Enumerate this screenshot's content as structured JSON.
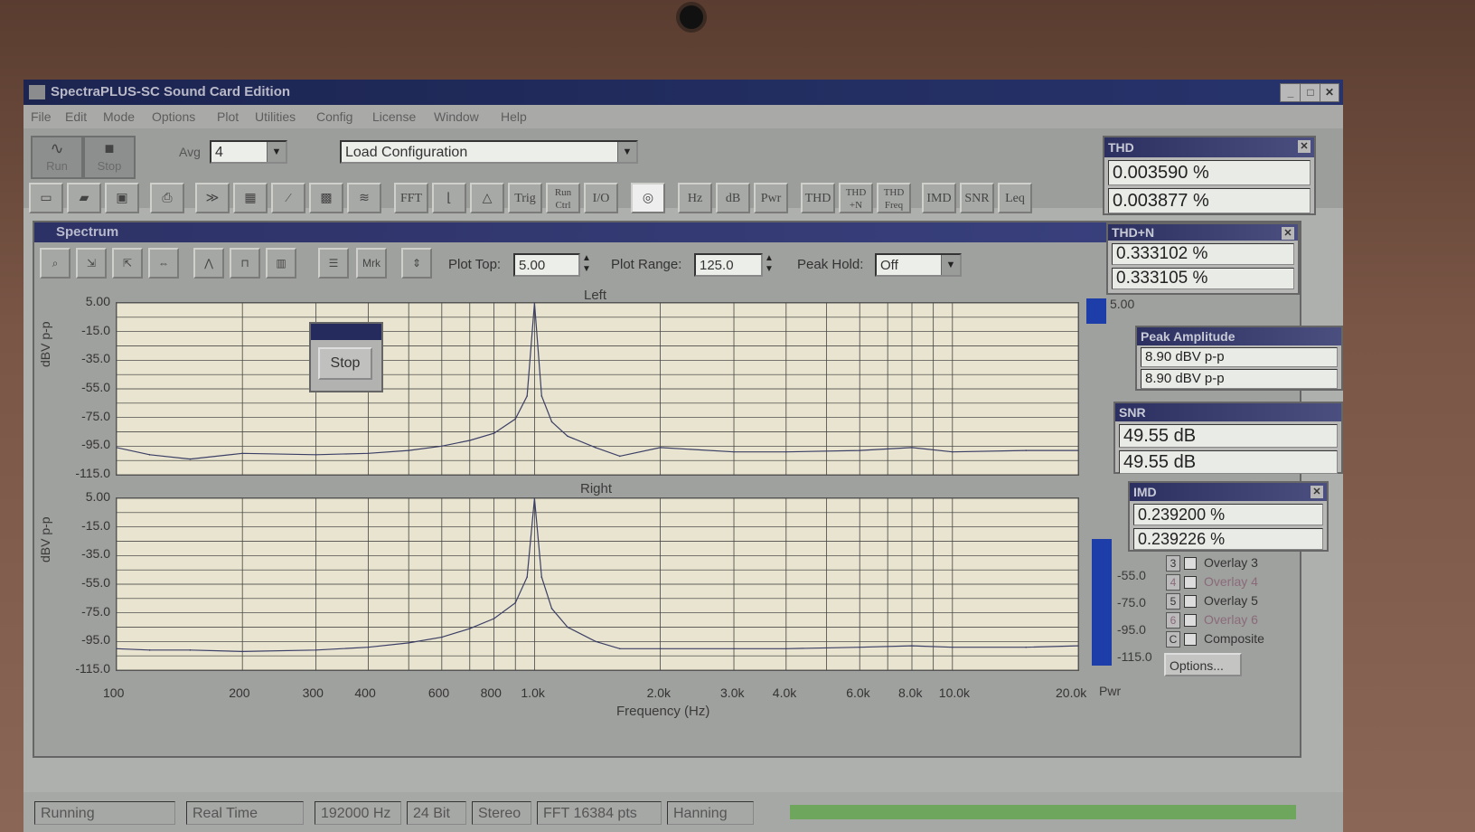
{
  "app": {
    "title": "SpectraPLUS-SC Sound Card Edition"
  },
  "menu": [
    "File",
    "Edit",
    "Mode",
    "Options",
    "Plot",
    "Utilities",
    "Config",
    "License",
    "Window",
    "Help"
  ],
  "toolbar": {
    "run_label": "Run",
    "stop_label": "Stop",
    "avg_label": "Avg",
    "avg_value": "4",
    "config_value": "Load Configuration",
    "buttons": [
      "FFT",
      "Trig",
      "Run Ctrl",
      "I/O",
      "Hz",
      "dB",
      "Pwr",
      "THD",
      "THD +N",
      "THD Freq",
      "IMD",
      "SNR",
      "Leq"
    ]
  },
  "spectrum": {
    "title": "Spectrum",
    "mrk_label": "Mrk",
    "plot_top_label": "Plot Top:",
    "plot_top_value": "5.00",
    "plot_range_label": "Plot Range:",
    "plot_range_value": "125.0",
    "peak_hold_label": "Peak Hold:",
    "peak_hold_value": "Off",
    "left_label": "Left",
    "right_label": "Right",
    "y_axis_label": "dBV p-p",
    "x_axis_label": "Frequency (Hz)",
    "y_ticks": [
      "5.00",
      "-15.0",
      "-35.0",
      "-55.0",
      "-75.0",
      "-95.0",
      "-115.0"
    ],
    "x_ticks": [
      "100",
      "200",
      "300",
      "400",
      "600",
      "800",
      "1.0k",
      "2.0k",
      "3.0k",
      "4.0k",
      "6.0k",
      "8.0k",
      "10.0k",
      "20.0k"
    ],
    "pwr_label": "Pwr"
  },
  "popup": {
    "stop_label": "Stop"
  },
  "thd": {
    "title": "THD",
    "values": [
      "0.003590 %",
      "0.003877 %"
    ]
  },
  "thdn": {
    "title": "THD+N",
    "values": [
      "0.333102 %",
      "0.333105 %"
    ]
  },
  "peak": {
    "title": "Peak Amplitude",
    "values": [
      "8.90 dBV p-p",
      "8.90 dBV p-p"
    ]
  },
  "snr": {
    "title": "SNR",
    "values": [
      "49.55 dB",
      "49.55 dB"
    ]
  },
  "imd": {
    "title": "IMD",
    "values": [
      "0.239200 %",
      "0.239226 %"
    ]
  },
  "side": {
    "meter_top": "5.00",
    "meter_ticks": [
      "-55.0",
      "-75.0",
      "-95.0",
      "-115.0"
    ],
    "options_label": "Options...",
    "overlays": [
      {
        "num": "3",
        "label": "Overlay 3"
      },
      {
        "num": "4",
        "label": "Overlay 4"
      },
      {
        "num": "5",
        "label": "Overlay 5"
      },
      {
        "num": "6",
        "label": "Overlay 6"
      },
      {
        "num": "C",
        "label": "Composite"
      }
    ]
  },
  "status": {
    "state": "Running",
    "mode": "Real Time",
    "rate": "192000 Hz",
    "bits": "24 Bit",
    "channels": "Stereo",
    "fft": "FFT 16384 pts",
    "window": "Hanning"
  },
  "colors": {
    "title_bar": "#27336c",
    "plot_bg": "#e8e4cf",
    "trace": "#3c3f66",
    "meter": "#1d3ea8",
    "progress": "#5fa54a"
  },
  "chart_data": [
    {
      "type": "line",
      "title": "Left",
      "xlabel": "Frequency (Hz)",
      "ylabel": "dBV p-p",
      "x_scale": "log",
      "xlim": [
        100,
        20000
      ],
      "ylim": [
        -115,
        5
      ],
      "grid": true,
      "series": [
        {
          "x": [
            100,
            120,
            150,
            200,
            300,
            400,
            500,
            600,
            700,
            800,
            900,
            960,
            1000,
            1040,
            1100,
            1200,
            1400,
            1600,
            2000,
            3000,
            4000,
            6000,
            8000,
            10000,
            15000,
            20000
          ],
          "y": [
            -96,
            -101,
            -104,
            -100,
            -101,
            -100,
            -98,
            -95,
            -91,
            -86,
            -76,
            -60,
            5,
            -60,
            -78,
            -88,
            -96,
            -102,
            -96,
            -99,
            -99,
            -98,
            -96,
            -99,
            -98,
            -98
          ]
        }
      ]
    },
    {
      "type": "line",
      "title": "Right",
      "xlabel": "Frequency (Hz)",
      "ylabel": "dBV p-p",
      "x_scale": "log",
      "xlim": [
        100,
        20000
      ],
      "ylim": [
        -115,
        5
      ],
      "grid": true,
      "series": [
        {
          "x": [
            100,
            120,
            150,
            200,
            300,
            400,
            500,
            600,
            700,
            800,
            900,
            960,
            1000,
            1040,
            1100,
            1200,
            1400,
            1600,
            2000,
            3000,
            4000,
            6000,
            8000,
            10000,
            15000,
            20000
          ],
          "y": [
            -100,
            -101,
            -101,
            -102,
            -101,
            -99,
            -96,
            -92,
            -86,
            -79,
            -68,
            -50,
            5,
            -50,
            -72,
            -85,
            -95,
            -100,
            -100,
            -100,
            -100,
            -99,
            -98,
            -99,
            -99,
            -98
          ]
        }
      ]
    }
  ]
}
